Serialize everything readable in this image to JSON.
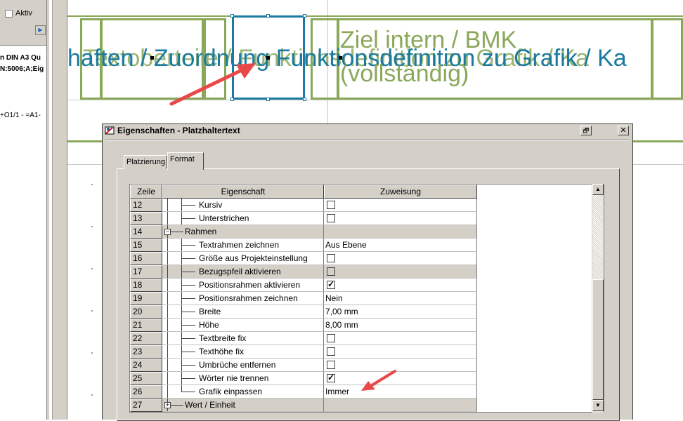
{
  "left_panel": {
    "aktiv_label": "Aktiv",
    "lines": [
      "n DIN A3 Qu",
      "N:5006;A;Eig",
      "+O1/1 - =A1-"
    ]
  },
  "canvas": {
    "overlap_text_blue": "haften / Zuordnung Funktionsdefinition zu Grafik / Ka",
    "overlap_text_green": "Textoberteile / Funktionsdefinition zu Grafik / Ka",
    "ziel_line1": "Ziel intern / BMK",
    "ziel_line2": "(vollständig)"
  },
  "dialog": {
    "title": "Eigenschaften - Platzhaltertext",
    "restore_glyph": "🗗",
    "close_glyph": "✕",
    "tabs": [
      {
        "label": "Platzierung",
        "active": false
      },
      {
        "label": "Format",
        "active": true
      }
    ],
    "grid": {
      "headers": [
        "Zeile",
        "Eigenschaft",
        "Zuweisung"
      ],
      "rows": [
        {
          "num": "12",
          "prop": "Kursiv",
          "level": 2,
          "type": "checkbox",
          "checked": false,
          "grey": false
        },
        {
          "num": "13",
          "prop": "Unterstrichen",
          "level": 2,
          "type": "checkbox",
          "checked": false,
          "grey": false
        },
        {
          "num": "14",
          "prop": "Rahmen",
          "level": 1,
          "type": "group",
          "expanded": true,
          "grey": true
        },
        {
          "num": "15",
          "prop": "Textrahmen zeichnen",
          "level": 2,
          "type": "text",
          "value": "Aus Ebene",
          "grey": false
        },
        {
          "num": "16",
          "prop": "Größe aus Projekteinstellung",
          "level": 2,
          "type": "checkbox",
          "checked": false,
          "grey": false
        },
        {
          "num": "17",
          "prop": "Bezugspfeil aktivieren",
          "level": 2,
          "type": "checkbox",
          "checked": false,
          "grey": true
        },
        {
          "num": "18",
          "prop": "Positionsrahmen aktivieren",
          "level": 2,
          "type": "checkbox",
          "checked": true,
          "grey": false
        },
        {
          "num": "19",
          "prop": "Positionsrahmen zeichnen",
          "level": 2,
          "type": "text",
          "value": "Nein",
          "grey": false
        },
        {
          "num": "20",
          "prop": "Breite",
          "level": 2,
          "type": "text",
          "value": "7,00 mm",
          "grey": false
        },
        {
          "num": "21",
          "prop": "Höhe",
          "level": 2,
          "type": "text",
          "value": "8,00 mm",
          "grey": false
        },
        {
          "num": "22",
          "prop": "Textbreite fix",
          "level": 2,
          "type": "checkbox",
          "checked": false,
          "grey": false
        },
        {
          "num": "23",
          "prop": "Texthöhe fix",
          "level": 2,
          "type": "checkbox",
          "checked": false,
          "grey": false
        },
        {
          "num": "24",
          "prop": "Umbrüche entfernen",
          "level": 2,
          "type": "checkbox",
          "checked": false,
          "grey": false
        },
        {
          "num": "25",
          "prop": "Wörter nie trennen",
          "level": 2,
          "type": "checkbox",
          "checked": true,
          "grey": false
        },
        {
          "num": "26",
          "prop": "Grafik einpassen",
          "level": 2,
          "type": "text",
          "value": "Immer",
          "grey": false,
          "last_in_group": true
        },
        {
          "num": "27",
          "prop": "Wert / Einheit",
          "level": 1,
          "type": "group",
          "expanded": false,
          "grey": true
        }
      ]
    }
  },
  "colors": {
    "placeholder_green": "#8aa85a",
    "selection_blue": "#1a7aa0",
    "arrow_red": "#e84848",
    "dialog_face": "#d4d0c8"
  },
  "icons": [
    "properties-dialog-icon",
    "restore-icon",
    "close-icon",
    "scroll-up-icon",
    "scroll-down-icon",
    "tree-minus-icon",
    "tree-plus-icon",
    "checkmark-icon",
    "red-arrow-annotation"
  ]
}
